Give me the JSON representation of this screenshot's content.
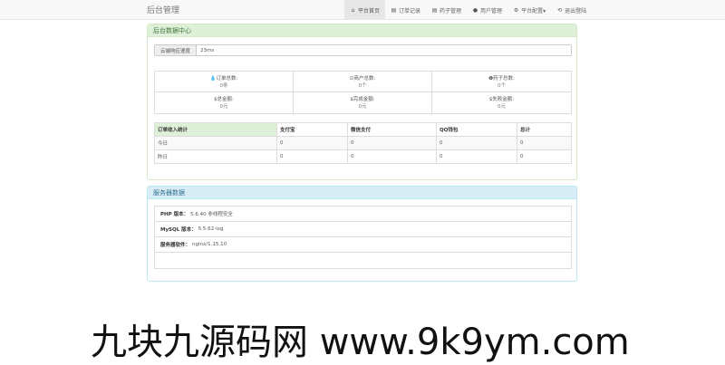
{
  "app": {
    "brand": "后台管理"
  },
  "nav": [
    {
      "icon": "home-icon",
      "glyph": "⌂",
      "label": "平台首页",
      "active": true
    },
    {
      "icon": "list-icon",
      "glyph": "▤",
      "label": "订单记录",
      "active": false
    },
    {
      "icon": "list-icon",
      "glyph": "▤",
      "label": "药子管理",
      "active": false
    },
    {
      "icon": "user-icon",
      "glyph": "●",
      "label": "用户管理",
      "active": false
    },
    {
      "icon": "gear-icon",
      "glyph": "⚙",
      "label": "平台配置▾",
      "active": false
    },
    {
      "icon": "logout-icon",
      "glyph": "⟲",
      "label": "退出登陆",
      "active": false
    }
  ],
  "data_panel": {
    "title": "后台数据中心",
    "speed_label": "云端响应速度",
    "speed_value": "23ms",
    "stats": [
      {
        "icon": "drop-icon",
        "label": "💧订单总数:",
        "value": "0条"
      },
      {
        "icon": "user-icon",
        "label": "☑商户总数:",
        "value": "0个"
      },
      {
        "icon": "info-icon",
        "label": "❶药子总数:",
        "value": "0个"
      },
      {
        "icon": "dollar-icon",
        "label": "$总金额:",
        "value": "0元"
      },
      {
        "icon": "dollar-icon",
        "label": "$完成金额:",
        "value": "0元"
      },
      {
        "icon": "dollar-icon",
        "label": "$失败金额:",
        "value": "0元"
      }
    ],
    "revenue_table": {
      "headers": [
        "订单收入统计",
        "支付宝",
        "微信支付",
        "QQ钱包",
        "总计"
      ],
      "rows": [
        [
          "今日",
          "0",
          "0",
          "0",
          "0"
        ],
        [
          "昨日",
          "0",
          "0",
          "0",
          "0"
        ]
      ]
    }
  },
  "server_panel": {
    "title": "服务器数据",
    "rows": [
      {
        "label": "PHP 版本：",
        "value": "5.6.40 非线程安全"
      },
      {
        "label": "MySQL 版本：",
        "value": "5.5.62-log"
      },
      {
        "label": "服务器软件：",
        "value": "nginx/1.15.10"
      }
    ]
  },
  "watermark": "九块九源码网 www.9k9ym.com"
}
